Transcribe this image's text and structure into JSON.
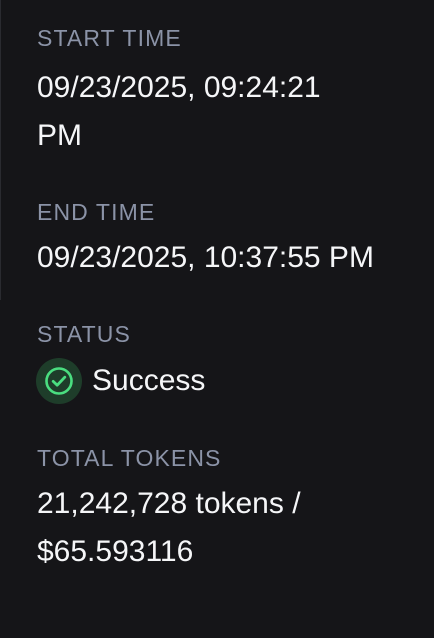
{
  "details": {
    "start_time": {
      "label": "START TIME",
      "value_line1": "09/23/2025, 09:24:21",
      "value_line2": "PM"
    },
    "end_time": {
      "label": "END TIME",
      "value": "09/23/2025, 10:37:55 PM"
    },
    "status": {
      "label": "STATUS",
      "value": "Success",
      "icon": "check-circle-icon",
      "color": "#4ade80"
    },
    "total_tokens": {
      "label": "TOTAL TOKENS",
      "value_line1": "21,242,728 tokens /",
      "value_line2": "$65.593116"
    }
  }
}
